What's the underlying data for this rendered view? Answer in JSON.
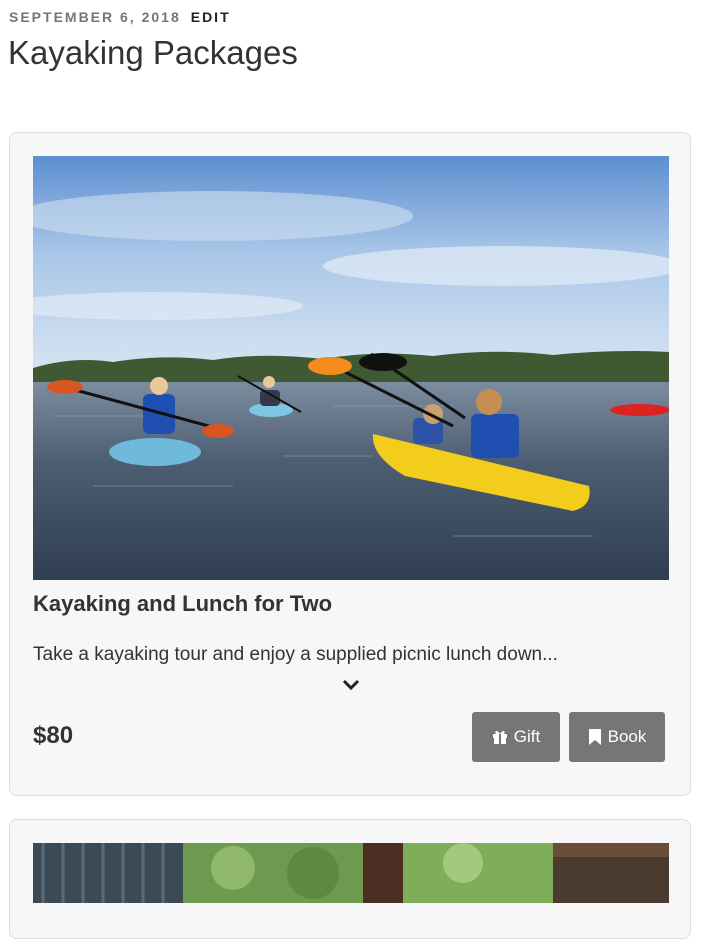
{
  "post": {
    "date": "September 6, 2018",
    "edit_label": "Edit",
    "title": "Kayaking Packages"
  },
  "packages": [
    {
      "title": "Kayaking and Lunch for Two",
      "description": "Take a kayaking tour and enjoy a supplied picnic lunch down...",
      "price": "$80",
      "gift_label": "Gift",
      "book_label": "Book"
    }
  ],
  "icons": {
    "expand": "chevron-down-icon",
    "gift": "gift-icon",
    "book": "bookmark-icon"
  },
  "colors": {
    "button_bg": "#767676",
    "card_bg": "#f7f7f7"
  }
}
